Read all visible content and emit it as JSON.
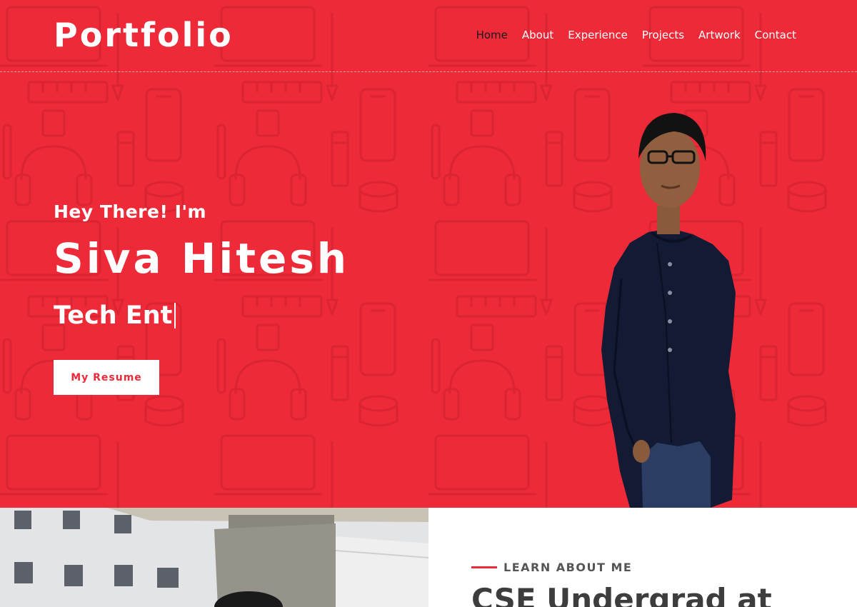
{
  "brand": "Portfolio",
  "nav": {
    "items": [
      "Home",
      "About",
      "Experience",
      "Projects",
      "Artwork",
      "Contact"
    ],
    "active": "Home"
  },
  "hero": {
    "greeting": "Hey There! I'm",
    "name": "Siva Hitesh",
    "typed": "Tech Ent",
    "cta": "My Resume"
  },
  "about": {
    "eyebrow": "LEARN ABOUT ME",
    "heading": "CSE Undergrad at"
  },
  "colors": {
    "accent": "#ee2a39",
    "dark": "#1b1b1b",
    "heading": "#3d3d3d"
  }
}
